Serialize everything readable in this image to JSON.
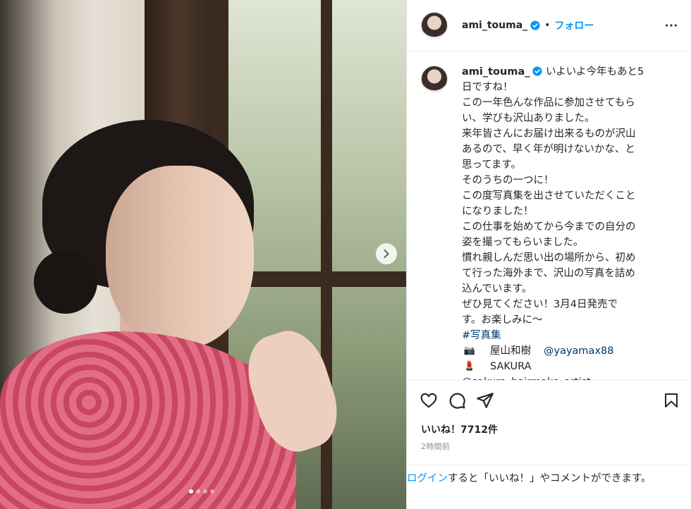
{
  "post": {
    "username": "ami_touma_",
    "separator": "•",
    "follow_label": "フォロー",
    "more_icon": "more-horizontal-icon",
    "verified_color": "#0095f6"
  },
  "caption": {
    "username": "ami_touma_",
    "first_line": "いよいよ今年もあと5",
    "lines": [
      "日ですね！",
      "この一年色んな作品に参加させてもら",
      "い、学びも沢山ありました。",
      "来年皆さんにお届け出来るものが沢山",
      "あるので、早く年が明けないかな、と",
      "思ってます。",
      "そのうちの一つに！",
      "この度写真集を出させていただくこと",
      "になりました！",
      "この仕事を始めてから今までの自分の",
      "姿を撮ってもらいました。",
      "慣れ親しんだ思い出の場所から、初め",
      "て行った海外まで、沢山の写真を詰め",
      "込んでいます。",
      "ぜひ見てください！3月4日発売で",
      "す。お楽しみに〜"
    ],
    "hashtag": "#写真集",
    "credits": [
      {
        "icon": "📷",
        "icon_name": "camera-emoji-icon",
        "name": "屋山和樹",
        "mention": "@yayamax88"
      },
      {
        "icon": "💄",
        "icon_name": "lipstick-emoji-icon",
        "name": "SAKURA",
        "mention": ""
      }
    ],
    "cut_mention": "@sakura_hairmake_artist"
  },
  "stats": {
    "likes": "いいね！7712件",
    "time": "2時間前"
  },
  "login_prompt": {
    "link": "ログイン",
    "text": "すると「いいね！」やコメントができます。"
  },
  "carousel": {
    "dots": 4,
    "active_index": 0
  }
}
